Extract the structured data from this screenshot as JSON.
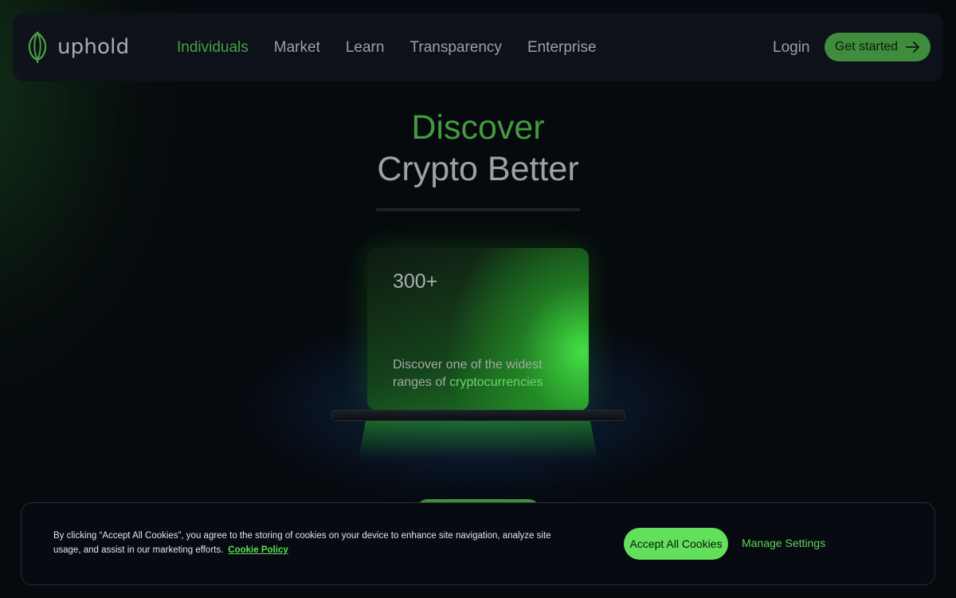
{
  "brand": {
    "name": "uphold",
    "logo_icon": "uphold-seed-icon",
    "accent_color": "#49a043"
  },
  "nav": {
    "links": [
      {
        "label": "Individuals",
        "active": true
      },
      {
        "label": "Market",
        "active": false
      },
      {
        "label": "Learn",
        "active": false
      },
      {
        "label": "Transparency",
        "active": false
      },
      {
        "label": "Enterprise",
        "active": false
      }
    ],
    "login_label": "Login",
    "cta_label": "Get started",
    "cta_icon": "arrow-right-icon"
  },
  "hero": {
    "title_line1": "Discover",
    "title_line2": "Crypto Better"
  },
  "feature_card": {
    "count": "300+",
    "description_prefix": "Discover one of the widest ranges of ",
    "description_highlight": "cryptocurrencies"
  },
  "cookie_banner": {
    "text": "By clicking “Accept All Cookies”, you agree to the storing of cookies on your device to enhance site navigation, analyze site usage, and assist in our marketing efforts.",
    "policy_link": "Cookie Policy",
    "accept_label": "Accept All Cookies",
    "manage_label": "Manage Settings"
  }
}
